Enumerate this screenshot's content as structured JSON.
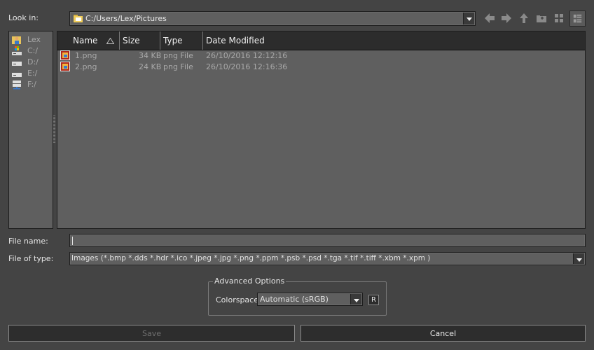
{
  "look_in": {
    "label": "Look in:",
    "path": "C:/Users/Lex/Pictures"
  },
  "toolbar": {
    "icons": [
      "back-arrow-icon",
      "forward-arrow-icon",
      "up-arrow-icon",
      "new-folder-icon",
      "list-view-icon",
      "detail-view-icon"
    ]
  },
  "sidebar": {
    "items": [
      {
        "label": "Lex",
        "icon": "user-folder-icon"
      },
      {
        "label": "C:/",
        "icon": "system-drive-icon"
      },
      {
        "label": "D:/",
        "icon": "drive-icon"
      },
      {
        "label": "E:/",
        "icon": "drive-icon"
      },
      {
        "label": "F:/",
        "icon": "network-drive-icon"
      }
    ]
  },
  "file_list": {
    "columns": [
      "Name",
      "Size",
      "Type",
      "Date Modified"
    ],
    "sort_column": "Name",
    "rows": [
      {
        "name": "1.png",
        "size": "34 KB",
        "type": "png File",
        "modified": "26/10/2016 12:12:16"
      },
      {
        "name": "2.png",
        "size": "24 KB",
        "type": "png File",
        "modified": "26/10/2016 12:16:36"
      }
    ]
  },
  "file_name": {
    "label": "File name:",
    "value": ""
  },
  "file_type": {
    "label": "File of type:",
    "value": "Images (*.bmp *.dds *.hdr *.ico *.jpeg *.jpg *.png *.ppm *.psb *.psd *.tga *.tif *.tiff *.xbm *.xpm )"
  },
  "advanced": {
    "title": "Advanced Options",
    "colorspace_label": "Colorspace",
    "colorspace_value": "Automatic (sRGB)",
    "reset_label": "R"
  },
  "buttons": {
    "save": "Save",
    "cancel": "Cancel"
  },
  "colors": {
    "background": "#444444",
    "field": "#5f5f5f",
    "header": "#2c2c2c",
    "disabled_text": "#6e6e6e"
  }
}
